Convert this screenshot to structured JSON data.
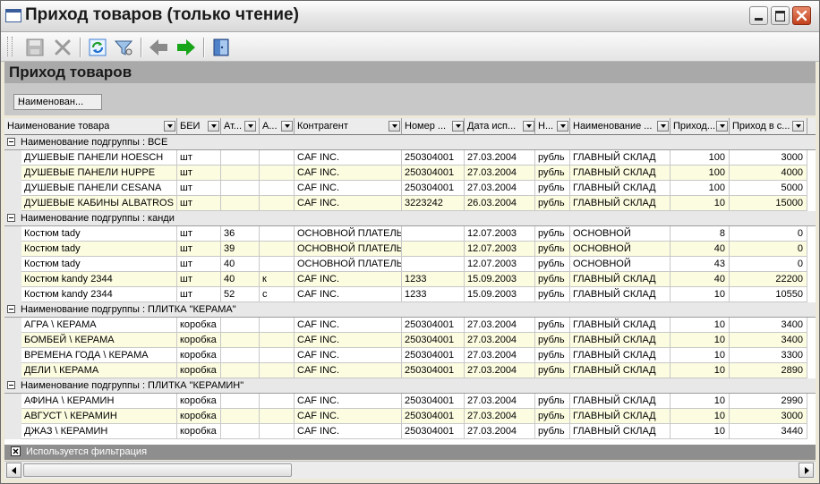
{
  "window": {
    "title": "Приход товаров (только чтение)"
  },
  "section": {
    "title": "Приход товаров"
  },
  "grouping": {
    "chip_label": "Наименован..."
  },
  "columns": [
    "Наименование товара",
    "БЕИ",
    "Ат...",
    "А...",
    "Контрагент",
    "Номер ...",
    "Дата исп...",
    "Н...",
    "Наименование ...",
    "Приход...",
    "Приход в с...",
    ""
  ],
  "groups": [
    {
      "label": "Наименование подгруппы : ВСЕ",
      "rows": [
        [
          "ДУШЕВЫЕ ПАНЕЛИ HOESCH",
          "шт",
          "",
          "",
          "CAF INC.",
          "250304001",
          "27.03.2004",
          "рубль",
          "ГЛАВНЫЙ СКЛАД",
          "100",
          "3000"
        ],
        [
          "ДУШЕВЫЕ ПАНЕЛИ HUPPE",
          "шт",
          "",
          "",
          "CAF INC.",
          "250304001",
          "27.03.2004",
          "рубль",
          "ГЛАВНЫЙ СКЛАД",
          "100",
          "4000"
        ],
        [
          "ДУШЕВЫЕ ПАНЕЛИ CESANA",
          "шт",
          "",
          "",
          "CAF INC.",
          "250304001",
          "27.03.2004",
          "рубль",
          "ГЛАВНЫЙ СКЛАД",
          "100",
          "5000"
        ],
        [
          "ДУШЕВЫЕ КАБИНЫ ALBATROS",
          "шт",
          "",
          "",
          "CAF INC.",
          "3223242",
          "26.03.2004",
          "рубль",
          "ГЛАВНЫЙ СКЛАД",
          "10",
          "15000"
        ]
      ]
    },
    {
      "label": "Наименование подгруппы : канди",
      "rows": [
        [
          "Костюм tady",
          "шт",
          "36",
          "",
          "ОСНОВНОЙ ПЛАТЕЛЬ",
          "",
          "12.07.2003",
          "рубль",
          "ОСНОВНОЙ",
          "8",
          "0"
        ],
        [
          "Костюм tady",
          "шт",
          "39",
          "",
          "ОСНОВНОЙ ПЛАТЕЛЬ",
          "",
          "12.07.2003",
          "рубль",
          "ОСНОВНОЙ",
          "40",
          "0"
        ],
        [
          "Костюм tady",
          "шт",
          "40",
          "",
          "ОСНОВНОЙ ПЛАТЕЛЬ",
          "",
          "12.07.2003",
          "рубль",
          "ОСНОВНОЙ",
          "43",
          "0"
        ],
        [
          "Костюм kandy 2344",
          "шт",
          "40",
          "к",
          "CAF INC.",
          "1233",
          "15.09.2003",
          "рубль",
          "ГЛАВНЫЙ СКЛАД",
          "40",
          "22200"
        ],
        [
          "Костюм kandy 2344",
          "шт",
          "52",
          "с",
          "CAF INC.",
          "1233",
          "15.09.2003",
          "рубль",
          "ГЛАВНЫЙ СКЛАД",
          "10",
          "10550"
        ]
      ]
    },
    {
      "label": "Наименование подгруппы : ПЛИТКА \"КЕРАМА\"",
      "rows": [
        [
          "АГРА \\ КЕРАМА",
          "коробка",
          "",
          "",
          "CAF INC.",
          "250304001",
          "27.03.2004",
          "рубль",
          "ГЛАВНЫЙ СКЛАД",
          "10",
          "3400"
        ],
        [
          "БОМБЕЙ \\ КЕРАМА",
          "коробка",
          "",
          "",
          "CAF INC.",
          "250304001",
          "27.03.2004",
          "рубль",
          "ГЛАВНЫЙ СКЛАД",
          "10",
          "3400"
        ],
        [
          "ВРЕМЕНА ГОДА \\ КЕРАМА",
          "коробка",
          "",
          "",
          "CAF INC.",
          "250304001",
          "27.03.2004",
          "рубль",
          "ГЛАВНЫЙ СКЛАД",
          "10",
          "3300"
        ],
        [
          "ДЕЛИ \\ КЕРАМА",
          "коробка",
          "",
          "",
          "CAF INC.",
          "250304001",
          "27.03.2004",
          "рубль",
          "ГЛАВНЫЙ СКЛАД",
          "10",
          "2890"
        ]
      ]
    },
    {
      "label": "Наименование подгруппы : ПЛИТКА \"КЕРАМИН\"",
      "rows": [
        [
          "АФИНА \\ КЕРАМИН",
          "коробка",
          "",
          "",
          "CAF INC.",
          "250304001",
          "27.03.2004",
          "рубль",
          "ГЛАВНЫЙ СКЛАД",
          "10",
          "2990"
        ],
        [
          "АВГУСТ \\ КЕРАМИН",
          "коробка",
          "",
          "",
          "CAF INC.",
          "250304001",
          "27.03.2004",
          "рубль",
          "ГЛАВНЫЙ СКЛАД",
          "10",
          "3000"
        ],
        [
          "ДЖАЗ \\ КЕРАМИН",
          "коробка",
          "",
          "",
          "CAF INC.",
          "250304001",
          "27.03.2004",
          "рубль",
          "ГЛАВНЫЙ СКЛАД",
          "10",
          "3440"
        ]
      ]
    }
  ],
  "status": {
    "filter_text": "Используется фильтрация"
  },
  "icons": {
    "toolbar": [
      "save-icon",
      "delete-icon",
      "refresh-icon",
      "filter-icon",
      "back-arrow-icon",
      "forward-arrow-icon",
      "exit-door-icon"
    ],
    "window": [
      "app-icon",
      "minimize-icon",
      "maximize-icon",
      "close-icon"
    ]
  },
  "colors": {
    "row_alt": "#fcfce0",
    "section_bar": "#a9a9a9",
    "status_bar": "#8e8e8e",
    "forward_arrow": "#19a519",
    "close_button": "#c2401c"
  }
}
